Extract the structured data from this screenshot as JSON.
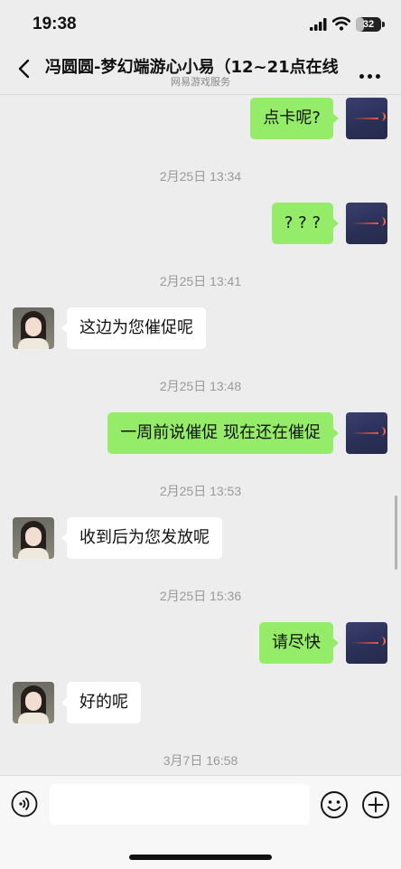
{
  "status": {
    "time": "19:38",
    "battery": "32",
    "battery_level": 0.32
  },
  "header": {
    "title": "冯圆圆-梦幻端游心小易（12~21点在线",
    "subtitle": "网易游戏服务"
  },
  "messages": [
    {
      "type": "out",
      "text": "点卡呢?"
    },
    {
      "type": "time",
      "text": "2月25日 13:34"
    },
    {
      "type": "out",
      "text": "? ? ?"
    },
    {
      "type": "time",
      "text": "2月25日 13:41"
    },
    {
      "type": "in",
      "text": "这边为您催促呢"
    },
    {
      "type": "time",
      "text": "2月25日 13:48"
    },
    {
      "type": "out",
      "text": "一周前说催促 现在还在催促"
    },
    {
      "type": "time",
      "text": "2月25日 13:53"
    },
    {
      "type": "in",
      "text": "收到后为您发放呢"
    },
    {
      "type": "time",
      "text": "2月25日 15:36"
    },
    {
      "type": "out",
      "text": "请尽快"
    },
    {
      "type": "in",
      "text": "好的呢"
    },
    {
      "type": "time",
      "text": "3月7日 16:58"
    }
  ],
  "input": {
    "placeholder": "",
    "value": ""
  },
  "icons": {
    "voice": "voice-icon",
    "emoji": "emoji-icon",
    "plus": "plus-icon",
    "back": "back-icon",
    "more": "more-icon"
  },
  "colors": {
    "out_bubble": "#95ec69",
    "in_bubble": "#ffffff",
    "background": "#ededed"
  }
}
